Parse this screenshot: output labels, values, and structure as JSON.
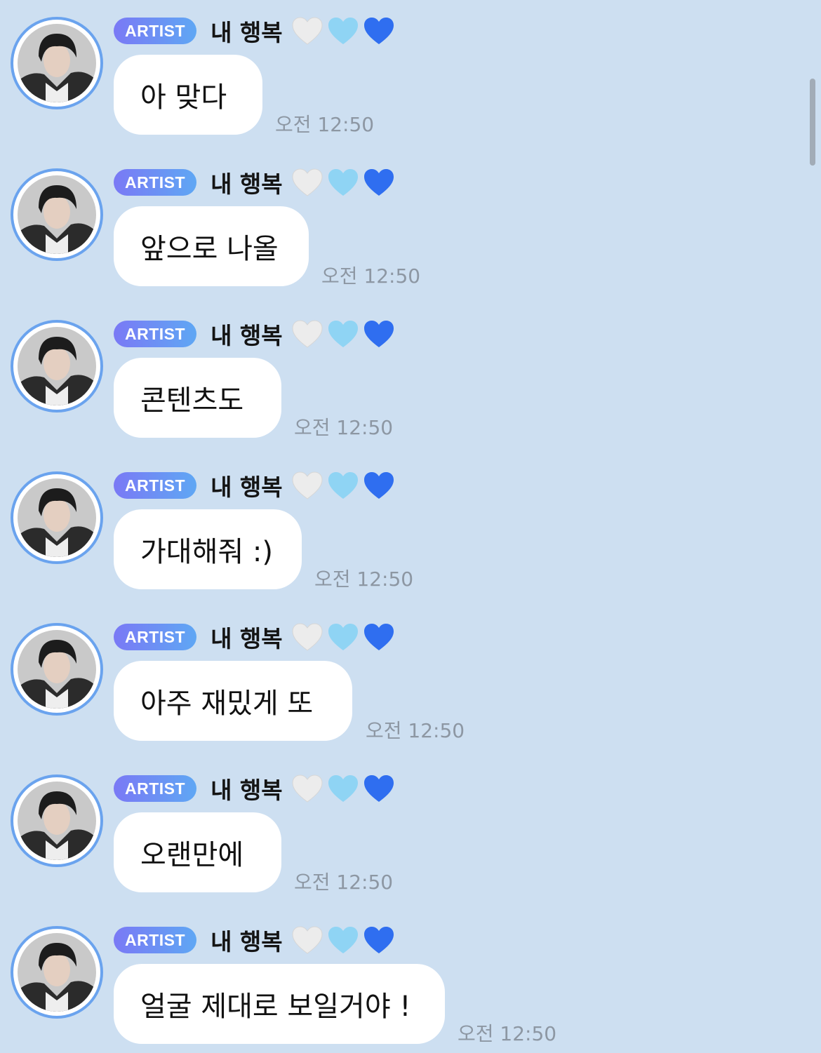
{
  "colors": {
    "background": "#cddff1",
    "bubble": "#ffffff",
    "badge_start": "#7a79f5",
    "badge_end": "#5fa7f4",
    "avatar_ring": "#6aa3ee",
    "time_text": "#8d97a3",
    "heart_white": "#ececec",
    "heart_light_blue": "#8fd4f4",
    "heart_blue": "#2f6ef0"
  },
  "sender": {
    "badge": "ARTIST",
    "name": "내 행복",
    "hearts": [
      "white-heart-icon",
      "light-blue-heart-icon",
      "blue-heart-icon"
    ]
  },
  "messages": [
    {
      "text": "아 맞다",
      "time": "오전 12:50"
    },
    {
      "text": "앞으로 나올",
      "time": "오전 12:50"
    },
    {
      "text": "콘텐츠도",
      "time": "오전 12:50"
    },
    {
      "text": "가대해줘 :)",
      "time": "오전 12:50"
    },
    {
      "text": "아주 재밌게 또",
      "time": "오전 12:50"
    },
    {
      "text": "오랜만에",
      "time": "오전 12:50"
    },
    {
      "text": "얼굴 제대로 보일거야 !",
      "time": "오전 12:50"
    }
  ]
}
